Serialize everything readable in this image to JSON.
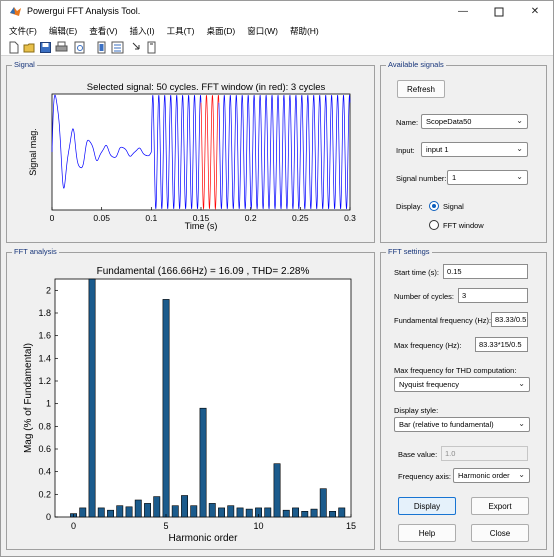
{
  "window": {
    "title": "Powergui FFT Analysis Tool."
  },
  "menu": [
    "文件(F)",
    "编辑(E)",
    "查看(V)",
    "插入(I)",
    "工具(T)",
    "桌面(D)",
    "窗口(W)",
    "帮助(H)"
  ],
  "signal_panel": {
    "title": "Signal",
    "plot_title": "Selected signal: 50 cycles. FFT window (in red): 3 cycles",
    "ylabel": "Signal mag.",
    "xlabel": "Time (s)",
    "xticks": [
      "0",
      "0.05",
      "0.1",
      "0.15",
      "0.2",
      "0.25",
      "0.3"
    ]
  },
  "available_signals": {
    "title": "Available signals",
    "refresh_label": "Refresh",
    "name_label": "Name:",
    "name_value": "ScopeData50",
    "input_label": "Input:",
    "input_value": "input 1",
    "signal_number_label": "Signal number:",
    "signal_number_value": "1",
    "display_label": "Display:",
    "display_signal_label": "Signal",
    "display_fft_label": "FFT window"
  },
  "fft_panel": {
    "title": "FFT analysis",
    "plot_title": "Fundamental (166.66Hz) = 16.09 , THD= 2.28%",
    "ylabel": "Mag (% of Fundamental)",
    "xlabel": "Harmonic order",
    "yticks": [
      "0",
      "0.2",
      "0.4",
      "0.6",
      "0.8",
      "1",
      "1.2",
      "1.4",
      "1.6",
      "1.8",
      "2"
    ],
    "xticks": [
      "0",
      "5",
      "10",
      "15"
    ]
  },
  "fft_settings": {
    "title": "FFT settings",
    "start_time_label": "Start time (s):",
    "start_time_value": "0.15",
    "num_cycles_label": "Number of cycles:",
    "num_cycles_value": "3",
    "fund_freq_label": "Fundamental frequency (Hz):",
    "fund_freq_value": "83.33/0.5",
    "max_freq_label": "Max frequency (Hz):",
    "max_freq_value": "83.33*15/0.5",
    "max_freq_thd_label": "Max frequency for THD computation:",
    "max_freq_thd_value": "Nyquist frequency",
    "display_style_label": "Display style:",
    "display_style_value": "Bar (relative to fundamental)",
    "base_value_label": "Base value:",
    "base_value_value": "1.0",
    "freq_axis_label": "Frequency axis:",
    "freq_axis_value": "Harmonic order",
    "display_button": "Display",
    "export_button": "Export",
    "help_button": "Help",
    "close_button": "Close"
  },
  "colors": {
    "signal_trace": "#0000ff",
    "fft_window_trace": "#ff0000",
    "bar_fill": "#1b5b8c",
    "panel_title": "#17357a"
  },
  "chart_data": [
    {
      "type": "line",
      "title": "Selected signal: 50 cycles. FFT window (in red): 3 cycles",
      "xlabel": "Time (s)",
      "ylabel": "Signal mag.",
      "xlim": [
        0,
        0.3
      ],
      "grid": false,
      "series": []
    },
    {
      "type": "bar",
      "title": "Fundamental (166.66Hz) = 16.09 , THD= 2.28%",
      "xlabel": "Harmonic order",
      "ylabel": "Mag (% of Fundamental)",
      "xlim": [
        -1,
        15
      ],
      "ylim": [
        0,
        2.1
      ],
      "grid": false,
      "categories": [
        0,
        0.5,
        1,
        1.5,
        2,
        2.5,
        3,
        3.5,
        4,
        4.5,
        5,
        5.5,
        6,
        6.5,
        7,
        7.5,
        8,
        8.5,
        9,
        9.5,
        10,
        10.5,
        11,
        11.5,
        12,
        12.5,
        13,
        13.5,
        14,
        14.5
      ],
      "values": [
        0.03,
        0.08,
        2.1,
        0.08,
        0.06,
        0.1,
        0.09,
        0.15,
        0.12,
        0.18,
        1.92,
        0.1,
        0.19,
        0.1,
        0.96,
        0.12,
        0.08,
        0.1,
        0.08,
        0.07,
        0.08,
        0.08,
        0.47,
        0.06,
        0.08,
        0.05,
        0.07,
        0.25,
        0.05,
        0.08
      ]
    }
  ]
}
